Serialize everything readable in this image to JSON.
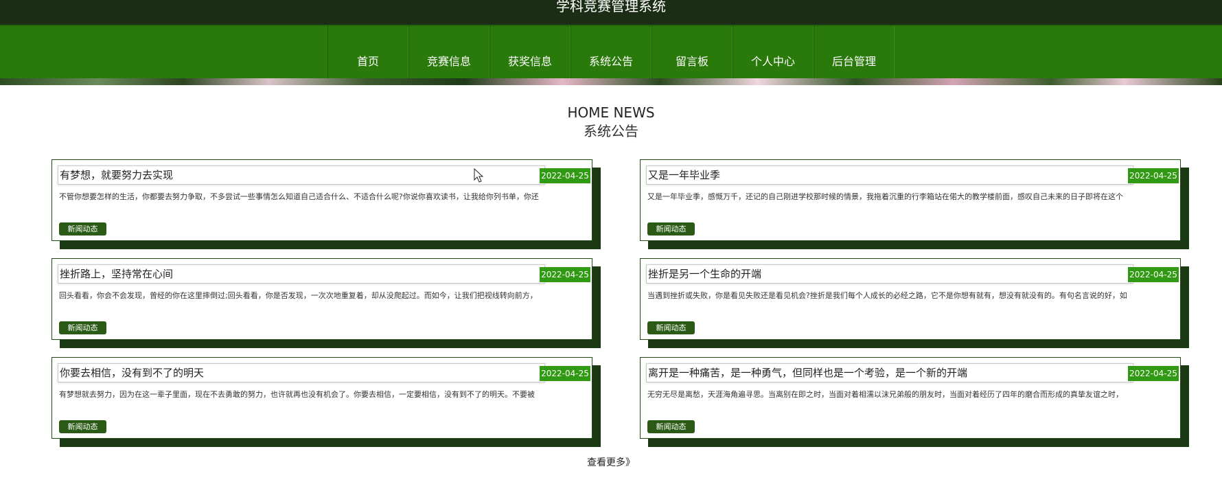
{
  "site": {
    "title": "学科竞赛管理系统"
  },
  "nav": {
    "items": [
      {
        "label": "首页"
      },
      {
        "label": "竞赛信息"
      },
      {
        "label": "获奖信息"
      },
      {
        "label": "系统公告"
      },
      {
        "label": "留言板"
      },
      {
        "label": "个人中心"
      },
      {
        "label": "后台管理"
      }
    ]
  },
  "section": {
    "title_en": "HOME NEWS",
    "title_cn": "系统公告"
  },
  "news": [
    {
      "title": "有梦想，就要努力去实现",
      "date": "2022-04-25",
      "excerpt": "不管你想要怎样的生活，你都要去努力争取，不多尝试一些事情怎么知道自己适合什么、不适合什么呢?你说你喜欢读书，让我给你列书单，你还",
      "tag": "新闻动态"
    },
    {
      "title": "又是一年毕业季",
      "date": "2022-04-25",
      "excerpt": "又是一年毕业季，感慨万千，还记的自己刚进学校那时候的情景，我拖着沉重的行李箱站在偌大的教学楼前面，感叹自己未来的日子即将在这个",
      "tag": "新闻动态"
    },
    {
      "title": "挫折路上，坚持常在心间",
      "date": "2022-04-25",
      "excerpt": "回头看看，你会不会发现，曾经的你在这里摔倒过;回头看看，你是否发现，一次次地重复着，却从没爬起过。而如今，让我们把视线转向前方，",
      "tag": "新闻动态"
    },
    {
      "title": "挫折是另一个生命的开端",
      "date": "2022-04-25",
      "excerpt": "当遇到挫折或失败，你是看见失败还是看见机会?挫折是我们每个人成长的必经之路，它不是你想有就有，想没有就没有的。有句名言说的好，如",
      "tag": "新闻动态"
    },
    {
      "title": "你要去相信，没有到不了的明天",
      "date": "2022-04-25",
      "excerpt": "有梦想就去努力，因为在这一辈子里面，现在不去勇敢的努力，也许就再也没有机会了。你要去相信，一定要相信，没有到不了的明天。不要被",
      "tag": "新闻动态"
    },
    {
      "title": "离开是一种痛苦，是一种勇气，但同样也是一个考验，是一个新的开端",
      "date": "2022-04-25",
      "excerpt": "无穷无尽是离愁，天涯海角遍寻思。当离别在即之时，当面对着相濡以沫兄弟般的朋友时，当面对着经历了四年的磨合而形成的真挚友谊之时，",
      "tag": "新闻动态"
    }
  ],
  "more": {
    "label": "查看更多》"
  },
  "colors": {
    "nav_bg": "#2a7a0b",
    "topbar_bg": "#1b2e15",
    "date_bg": "#2f9a12",
    "tag_bg": "#2a5a16",
    "shadow": "#1b3a14"
  }
}
